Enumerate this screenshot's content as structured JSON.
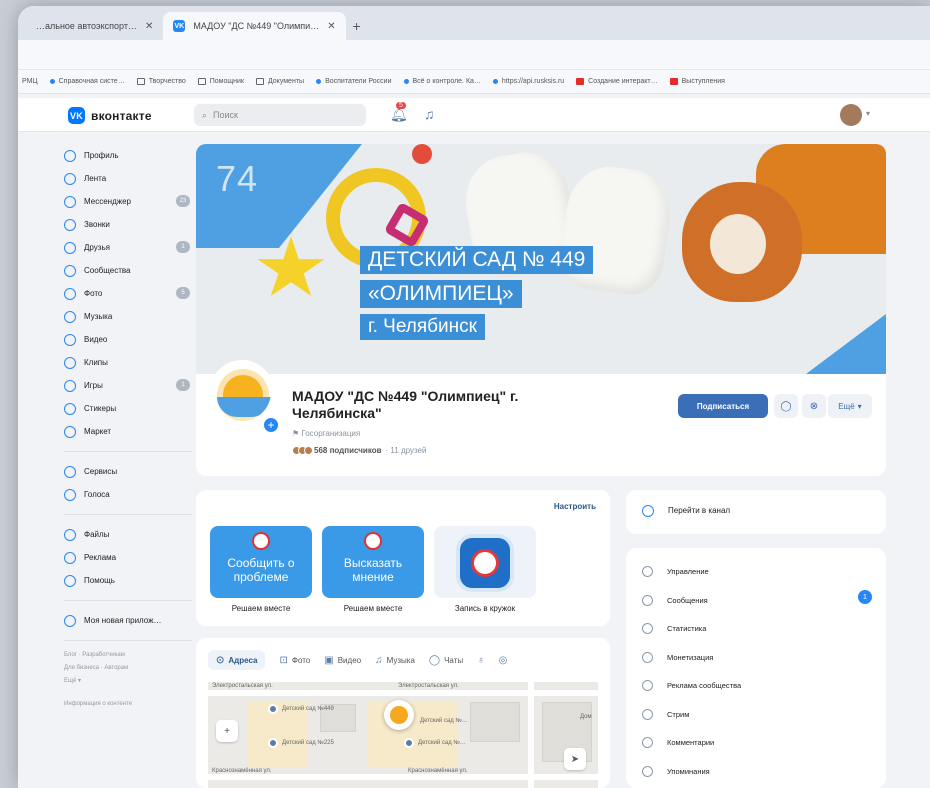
{
  "browser": {
    "tabs": [
      {
        "label": "…альное автоэкспорт…",
        "active": false
      },
      {
        "label": "МАДОУ \"ДС №449 \"Олимпи…",
        "active": true
      }
    ],
    "new_tab": "+",
    "bookmarks": [
      "РМЦ",
      "Справочная систе…",
      "Творчество",
      "Помощник",
      "Документы",
      "Воспитатели России",
      "Всё о контроле. Ка…",
      "https://api.rusksis.ru",
      "Создание интеракт…",
      "Выступления"
    ]
  },
  "vk": {
    "logo": "вконтакте",
    "logo_mark": "VK",
    "search_placeholder": "Поиск",
    "notifications_count": "5",
    "menu": [
      {
        "label": "Профиль",
        "icon": "profile-icon"
      },
      {
        "label": "Лента",
        "icon": "feed-icon"
      },
      {
        "label": "Мессенджер",
        "icon": "messenger-icon",
        "count": "23"
      },
      {
        "label": "Звонки",
        "icon": "calls-icon"
      },
      {
        "label": "Друзья",
        "icon": "friends-icon",
        "count": "1"
      },
      {
        "label": "Сообщества",
        "icon": "communities-icon"
      },
      {
        "label": "Фото",
        "icon": "photo-icon",
        "count": "5"
      },
      {
        "label": "Музыка",
        "icon": "music-icon"
      },
      {
        "label": "Видео",
        "icon": "video-icon"
      },
      {
        "label": "Клипы",
        "icon": "clips-icon"
      },
      {
        "label": "Игры",
        "icon": "games-icon",
        "count": "1"
      },
      {
        "label": "Стикеры",
        "icon": "stickers-icon"
      },
      {
        "label": "Маркет",
        "icon": "market-icon"
      }
    ],
    "menu2": [
      {
        "label": "Сервисы",
        "icon": "services-icon"
      },
      {
        "label": "Голоса",
        "icon": "votes-icon"
      }
    ],
    "menu3": [
      {
        "label": "Файлы",
        "icon": "files-icon"
      },
      {
        "label": "Реклама",
        "icon": "ads-icon"
      },
      {
        "label": "Помощь",
        "icon": "help-icon"
      }
    ],
    "menu4": [
      {
        "label": "Моя новая прилож…",
        "icon": "app-icon"
      }
    ],
    "footer": [
      "Блог · Разработчикам",
      "Для бизнеса · Авторам",
      "Ещё ▾"
    ],
    "footer_info": "Информация о контенте"
  },
  "cover": {
    "number": "74",
    "line1": "ДЕТСКИЙ САД № 449",
    "line2": "«ОЛИМПИЕЦ»",
    "line3": "г. Челябинск"
  },
  "group": {
    "name": "МАДОУ \"ДС №449 \"Олимпиец\" г. Челябинска\"",
    "type": "Госорганизация",
    "subscribers": "568 подписчиков",
    "friends": "· 11 друзей",
    "subscribe_label": "Подписаться",
    "more_label": "Ещё"
  },
  "widgets": {
    "setup_label": "Настроить",
    "items": [
      {
        "title": "Сообщить о проблеме",
        "caption": "Решаем вместе"
      },
      {
        "title": "Высказать мнение",
        "caption": "Решаем вместе"
      },
      {
        "title": "",
        "caption": "Запись в кружок"
      }
    ]
  },
  "map": {
    "tabs": [
      "Адреса",
      "Фото",
      "Видео",
      "Музыка",
      "Чаты"
    ],
    "labels": [
      "Электростальская ул.",
      "Электростальская ул.",
      "Детский сад №449",
      "Детский сад №…",
      "Детский сад №225",
      "Детский сад №…",
      "Краснознамённая ул.",
      "Краснознамённая ул.",
      "Дом"
    ]
  },
  "right": {
    "channel_label": "Перейти в канал",
    "items": [
      "Управление",
      "Сообщения",
      "Статистика",
      "Монетизация",
      "Реклама сообщества",
      "Стрим",
      "Комментарии",
      "Упоминания"
    ],
    "messages_badge": "1"
  },
  "colors": {
    "accent": "#2787f5",
    "cover_blue": "#3b8fd6",
    "subscribe": "#3a6eb6"
  }
}
